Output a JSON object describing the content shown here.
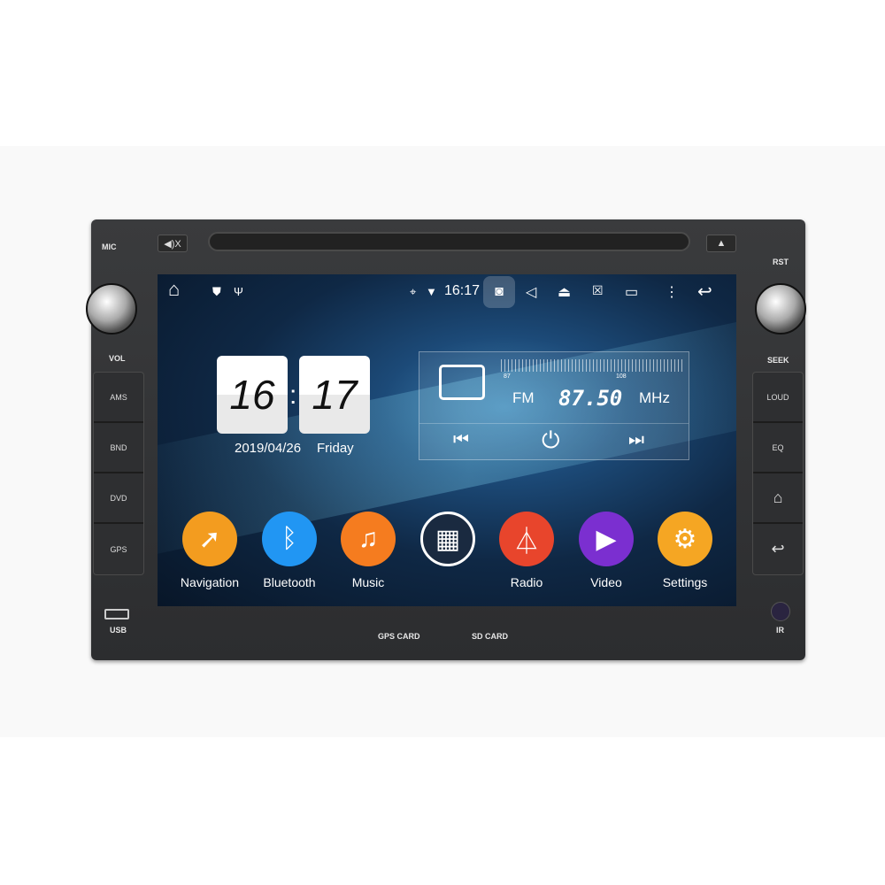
{
  "device": {
    "mic": "MIC",
    "mute": "◀)X",
    "rst": "RST",
    "vol": "VOL",
    "seek": "SEEK",
    "usb": "USB",
    "ir": "IR",
    "gps_card": "GPS CARD",
    "sd_card": "SD CARD",
    "left_buttons": [
      "AMS",
      "BND",
      "DVD",
      "GPS"
    ],
    "right_buttons": [
      "LOUD",
      "EQ",
      "home-icon",
      "back-icon"
    ]
  },
  "status_bar": {
    "time": "16:17",
    "icons": [
      "home-icon",
      "shield-icon",
      "usb-icon",
      "location-icon",
      "wifi-icon",
      "camera-icon",
      "volume-icon",
      "eject-icon",
      "close-window-icon",
      "recent-apps-icon",
      "more-icon",
      "back-icon"
    ]
  },
  "clock": {
    "hour": "16",
    "minute": "17",
    "date": "2019/04/26",
    "weekday": "Friday"
  },
  "radio": {
    "band": "FM",
    "frequency": "87.50",
    "unit": "MHz",
    "scale_min": "87",
    "scale_max": "108"
  },
  "apps": [
    {
      "label": "Navigation",
      "color": "#f39c1f",
      "icon": "compass-icon"
    },
    {
      "label": "Bluetooth",
      "color": "#2196f3",
      "icon": "bluetooth-icon"
    },
    {
      "label": "Music",
      "color": "#f57c1f",
      "icon": "music-icon"
    },
    {
      "label": "",
      "color": "#1a2a40",
      "icon": "apps-grid-icon"
    },
    {
      "label": "Radio",
      "color": "#e8452c",
      "icon": "antenna-icon"
    },
    {
      "label": "Video",
      "color": "#7b2fd0",
      "icon": "play-icon"
    },
    {
      "label": "Settings",
      "color": "#f5a623",
      "icon": "gear-icon"
    }
  ]
}
